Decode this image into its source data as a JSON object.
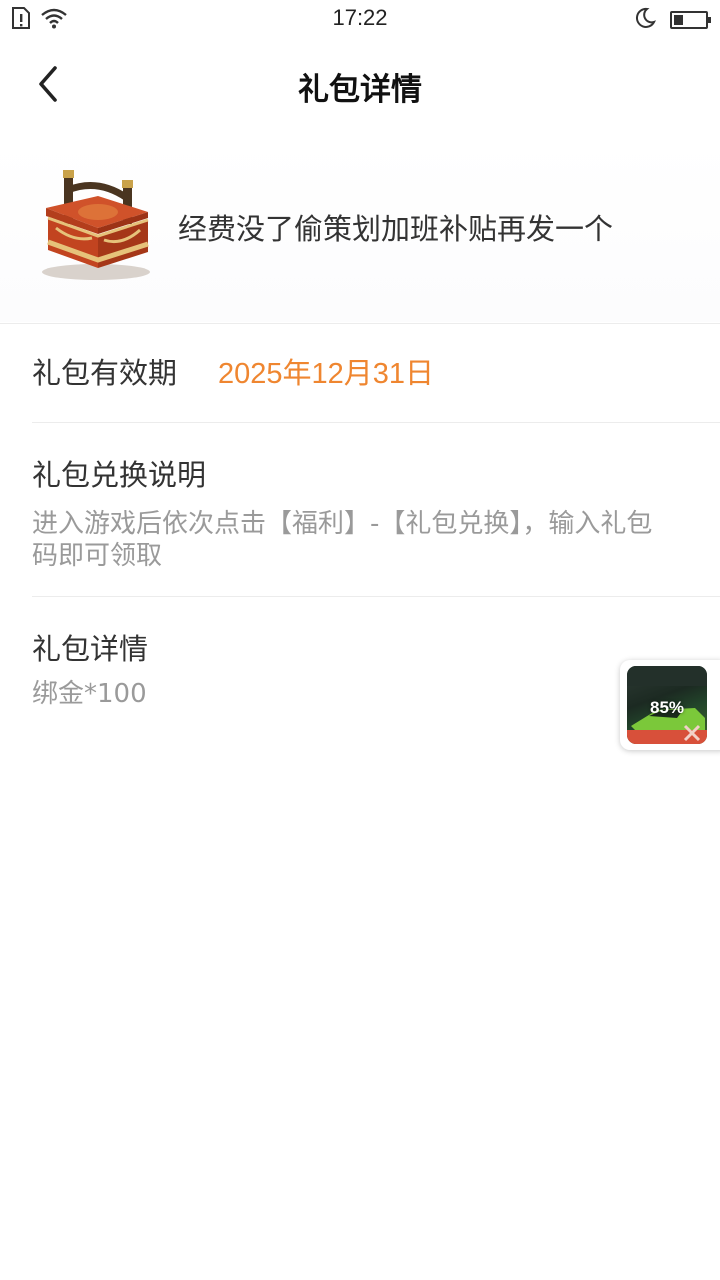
{
  "status_bar": {
    "time": "17:22",
    "icons": [
      "sim-alert-icon",
      "wifi-icon",
      "moon-icon",
      "battery-icon"
    ],
    "battery_level": 0.3
  },
  "nav": {
    "title": "礼包详情",
    "back_icon": "chevron-left-icon"
  },
  "gift": {
    "image_icon": "treasure-chest-icon",
    "name": "经费没了偷策划加班补贴再发一个"
  },
  "validity": {
    "label": "礼包有效期",
    "value": "2025年12月31日",
    "value_color": "#ef8630"
  },
  "redeem": {
    "title": "礼包兑换说明",
    "description": "进入游戏后依次点击【福利】-【礼包兑换】，输入礼包码即可领取"
  },
  "details": {
    "title": "礼包详情",
    "content": "绑金*100"
  },
  "floating_download": {
    "progress_text": "85%",
    "progress": 0.85,
    "thumb_icon": "racing-game-icon"
  }
}
